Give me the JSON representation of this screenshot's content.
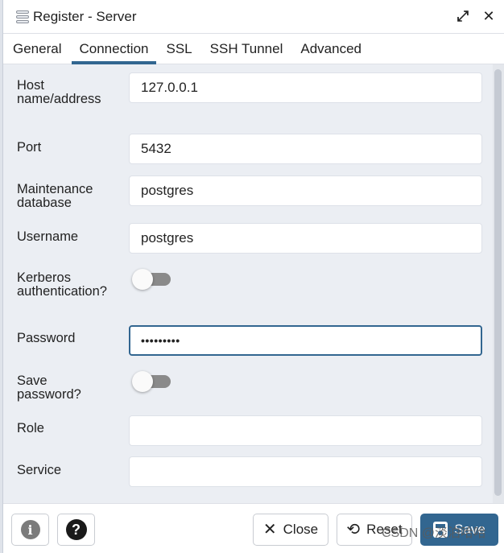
{
  "dialog": {
    "title": "Register - Server",
    "icons": {
      "title": "server-icon",
      "expand": "expand-icon",
      "close": "close-icon"
    }
  },
  "tabs": [
    {
      "label": "General",
      "active": false
    },
    {
      "label": "Connection",
      "active": true
    },
    {
      "label": "SSL",
      "active": false
    },
    {
      "label": "SSH Tunnel",
      "active": false
    },
    {
      "label": "Advanced",
      "active": false
    }
  ],
  "form": {
    "host": {
      "label": "Host name/address",
      "value": "127.0.0.1"
    },
    "port": {
      "label": "Port",
      "value": "5432"
    },
    "maintenance_db": {
      "label": "Maintenance database",
      "value": "postgres"
    },
    "username": {
      "label": "Username",
      "value": "postgres"
    },
    "kerberos": {
      "label": "Kerberos authentication?",
      "checked": false
    },
    "password": {
      "label": "Password",
      "value": "•••••••••"
    },
    "save_password": {
      "label": "Save password?",
      "checked": false
    },
    "role": {
      "label": "Role",
      "value": ""
    },
    "service": {
      "label": "Service",
      "value": ""
    }
  },
  "footer": {
    "info_icon": "i",
    "help_icon": "?",
    "close_label": "Close",
    "reset_label": "Reset",
    "save_label": "Save",
    "close_glyph": "✕",
    "reset_glyph": "⟲"
  },
  "accent_color": "#326690",
  "watermark": "CSDN @淡泊哈哈"
}
